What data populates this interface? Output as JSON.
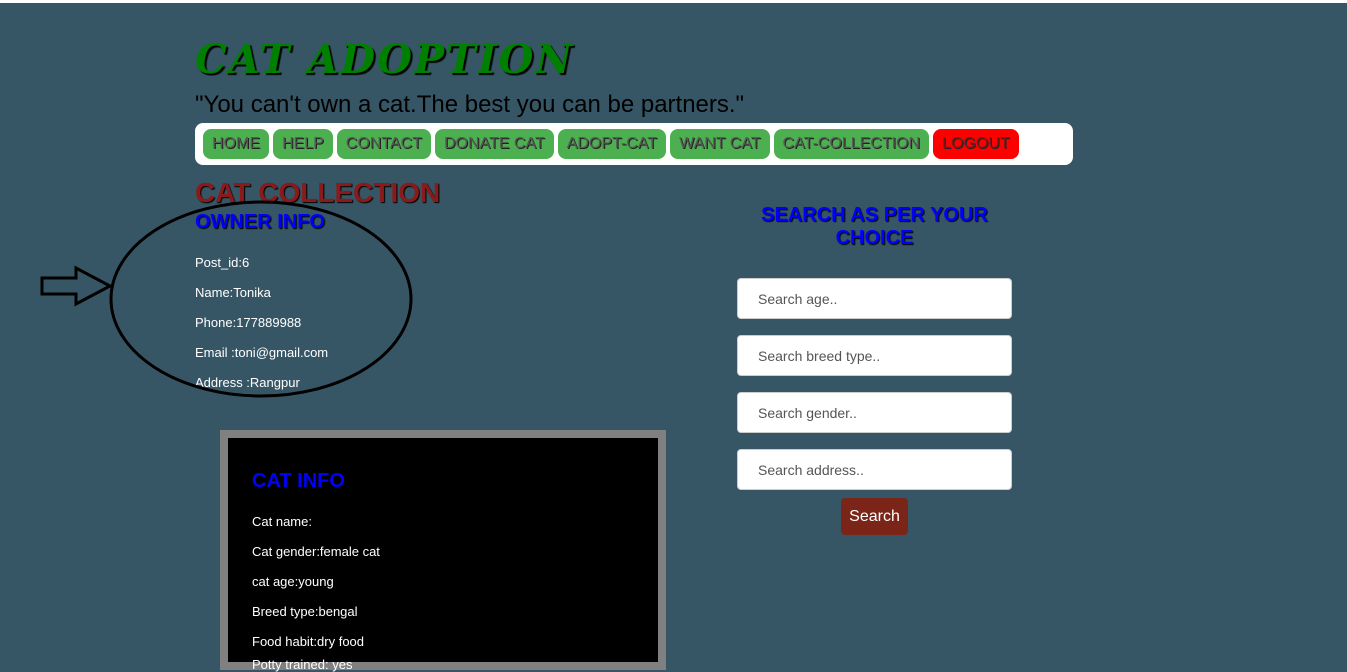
{
  "header": {
    "title": "CAT ADOPTION",
    "tagline": "\"You can't own a cat.The best you can be partners.\""
  },
  "nav": {
    "items": [
      {
        "label": "HOME"
      },
      {
        "label": "HELP"
      },
      {
        "label": "CONTACT"
      },
      {
        "label": "DONATE CAT"
      },
      {
        "label": "ADOPT-CAT"
      },
      {
        "label": "WANT CAT"
      },
      {
        "label": "CAT-COLLECTION"
      },
      {
        "label": "LOGOUT"
      }
    ]
  },
  "page_title": "CAT COLLECTION",
  "owner": {
    "title": "OWNER INFO",
    "post_id": "Post_id:6",
    "name": "Name:Tonika",
    "phone": "Phone:177889988",
    "email": "Email :toni@gmail.com",
    "address": "Address :Rangpur"
  },
  "cat": {
    "title": "CAT INFO",
    "name": "Cat name:",
    "gender": "Cat gender:female cat",
    "age": "cat age:young",
    "breed": "Breed type:bengal",
    "food": "Food habit:dry food",
    "potty": "Potty trained: yes"
  },
  "search": {
    "title": "SEARCH AS PER YOUR CHOICE",
    "age_placeholder": "Search age..",
    "breed_placeholder": "Search breed type..",
    "gender_placeholder": "Search gender..",
    "address_placeholder": "Search address..",
    "button_label": "Search"
  },
  "colors": {
    "background": "#375665",
    "nav_button": "#4caf50",
    "logout_button": "#ff0000",
    "search_button": "#7a2518",
    "heading_blue": "#0000ff",
    "title_green": "#008000"
  }
}
